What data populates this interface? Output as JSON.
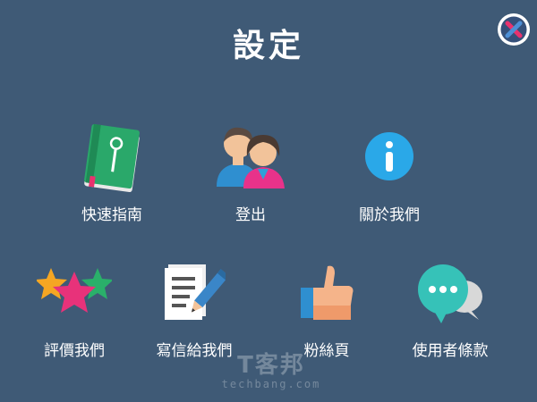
{
  "header": {
    "title": "設定"
  },
  "close_button": {
    "icon": "close-icon"
  },
  "menu": {
    "row1": [
      {
        "label": "快速指南",
        "icon": "guide-book-icon"
      },
      {
        "label": "登出",
        "icon": "users-icon"
      },
      {
        "label": "關於我們",
        "icon": "info-icon"
      }
    ],
    "row2": [
      {
        "label": "評價我們",
        "icon": "stars-icon"
      },
      {
        "label": "寫信給我們",
        "icon": "write-note-icon"
      },
      {
        "label": "粉絲頁",
        "icon": "thumbs-up-icon"
      },
      {
        "label": "使用者條款",
        "icon": "chat-bubble-icon"
      }
    ]
  },
  "watermark": {
    "brand": "T客邦",
    "domain": "techbang.com"
  },
  "colors": {
    "background": "#3f5a76",
    "text": "#ffffff"
  }
}
